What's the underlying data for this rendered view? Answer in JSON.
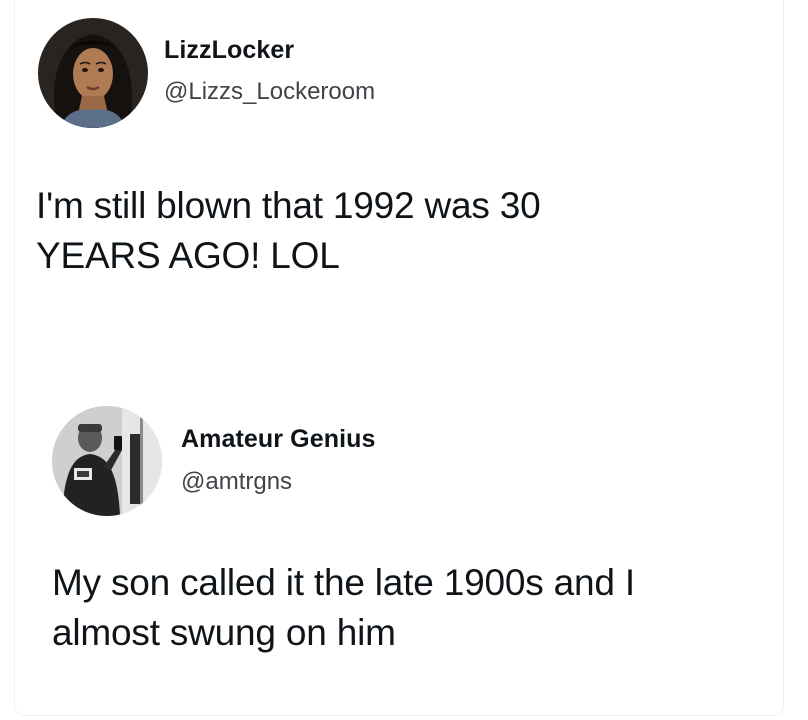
{
  "tweets": [
    {
      "display_name": "LizzLocker",
      "handle": "@Lizzs_Lockeroom",
      "text_line_1": "I'm still blown that 1992 was 30",
      "text_line_2": "YEARS AGO! LOL",
      "avatar_icon": "cartoon-woman-avatar"
    },
    {
      "display_name": "Amateur Genius",
      "handle": "@amtrgns",
      "text_line_1": "My son called it the late 1900s and I",
      "text_line_2": "almost swung on him",
      "avatar_icon": "mirror-selfie-avatar"
    }
  ]
}
